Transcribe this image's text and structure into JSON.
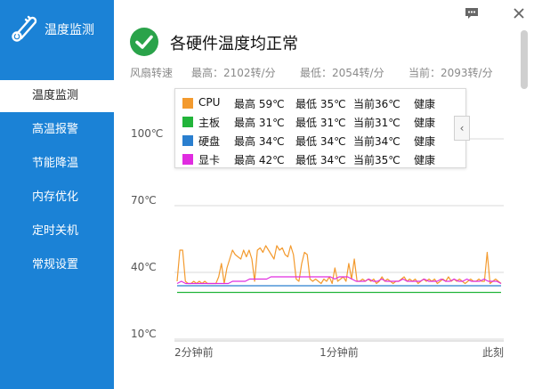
{
  "app": {
    "title": "温度监测"
  },
  "sidebar": {
    "items": [
      {
        "label": "温度监测",
        "active": true
      },
      {
        "label": "高温报警"
      },
      {
        "label": "节能降温"
      },
      {
        "label": "内存优化"
      },
      {
        "label": "定时关机"
      },
      {
        "label": "常规设置"
      }
    ]
  },
  "window": {
    "menu_icon": "chat-menu-icon",
    "close_icon": "close-icon"
  },
  "header": {
    "status_text": "各硬件温度均正常",
    "status_color": "#2aa34a",
    "fan": {
      "label": "风扇转速",
      "max": "最高：2102转/分",
      "min": "最低：2054转/分",
      "current": "当前：2093转/分"
    }
  },
  "legend": {
    "rows": [
      {
        "name": "CPU",
        "color": "#f39a2e",
        "max": "最高 59℃",
        "min": "最低 35℃",
        "current": "当前36℃",
        "status": "健康"
      },
      {
        "name": "主板",
        "color": "#22b43a",
        "max": "最高 31℃",
        "min": "最低 31℃",
        "current": "当前31℃",
        "status": "健康"
      },
      {
        "name": "硬盘",
        "color": "#2a7fcf",
        "max": "最高 34℃",
        "min": "最低 34℃",
        "current": "当前34℃",
        "status": "健康"
      },
      {
        "name": "显卡",
        "color": "#e02ce0",
        "max": "最高 42℃",
        "min": "最低 34℃",
        "current": "当前35℃",
        "status": "健康"
      }
    ],
    "collapse_glyph": "‹"
  },
  "chart_data": {
    "type": "line",
    "title": "",
    "xlabel": "",
    "ylabel": "",
    "ylim": [
      10,
      100
    ],
    "yticks": [
      "100℃",
      "70℃",
      "40℃",
      "10℃"
    ],
    "ytick_values": [
      100,
      70,
      40,
      10
    ],
    "xticks": [
      "2分钟前",
      "1分钟前",
      "此刻"
    ],
    "xtick_positions": [
      0,
      0.5,
      1
    ],
    "grid": true,
    "series": [
      {
        "name": "CPU",
        "color": "#f39a2e",
        "values": [
          36,
          50,
          50,
          36,
          35,
          35,
          36,
          35,
          36,
          35,
          36,
          35,
          35,
          35,
          35,
          38,
          44,
          35,
          42,
          46,
          50,
          48,
          47,
          46,
          50,
          47,
          50,
          46,
          36,
          50,
          51,
          49,
          52,
          50,
          48,
          46,
          52,
          50,
          51,
          48,
          47,
          52,
          48,
          37,
          36,
          44,
          49,
          48,
          37,
          36,
          37,
          36,
          35,
          37,
          36,
          38,
          35,
          42,
          36,
          37,
          38,
          36,
          44,
          37,
          46,
          36,
          36,
          37,
          36,
          37,
          36,
          37,
          35,
          36,
          38,
          36,
          37,
          36,
          35,
          36,
          36,
          37,
          38,
          36,
          37,
          36,
          37,
          35,
          36,
          37,
          36,
          37,
          36,
          37,
          35,
          36,
          37,
          36,
          38,
          36,
          37,
          36,
          37,
          36,
          35,
          36,
          37,
          36,
          36,
          37,
          36,
          36,
          49,
          35,
          36,
          37,
          36,
          35
        ]
      },
      {
        "name": "主板",
        "color": "#22b43a",
        "values": [
          31,
          31,
          31,
          31,
          31,
          31,
          31,
          31,
          31,
          31,
          31,
          31,
          31,
          31,
          31,
          31,
          31,
          31,
          31,
          31,
          31,
          31,
          31,
          31,
          31,
          31,
          31,
          31,
          31,
          31,
          31,
          31,
          31,
          31,
          31,
          31,
          31,
          31,
          31,
          31
        ]
      },
      {
        "name": "硬盘",
        "color": "#2a7fcf",
        "values": [
          34,
          34,
          34,
          34,
          34,
          34,
          34,
          34,
          34,
          34,
          34,
          34,
          34,
          34,
          34,
          34,
          34,
          34,
          34,
          34,
          34,
          34,
          34,
          34,
          34,
          34,
          34,
          34,
          34,
          34,
          34,
          34,
          34,
          34,
          34,
          34,
          34,
          34,
          34,
          34
        ]
      },
      {
        "name": "显卡",
        "color": "#e02ce0",
        "values": [
          35,
          36,
          35,
          35,
          35,
          35,
          35,
          35,
          35,
          35,
          35,
          35,
          35,
          36,
          36,
          36,
          36,
          37,
          37,
          37,
          37,
          37,
          38,
          38,
          38,
          38,
          38,
          38,
          38,
          38,
          38,
          38,
          38,
          38,
          38,
          38,
          38,
          37,
          38,
          38,
          38,
          37,
          36,
          36,
          36,
          37,
          36,
          36,
          37,
          36,
          36,
          36,
          36,
          37,
          36,
          36,
          36,
          36,
          37,
          36,
          36,
          36,
          37,
          36,
          36,
          37,
          36,
          36,
          37,
          36,
          36,
          36,
          37,
          36,
          36,
          36,
          35
        ]
      }
    ]
  },
  "scrollbar": {
    "thumb": "scroll-thumb"
  }
}
